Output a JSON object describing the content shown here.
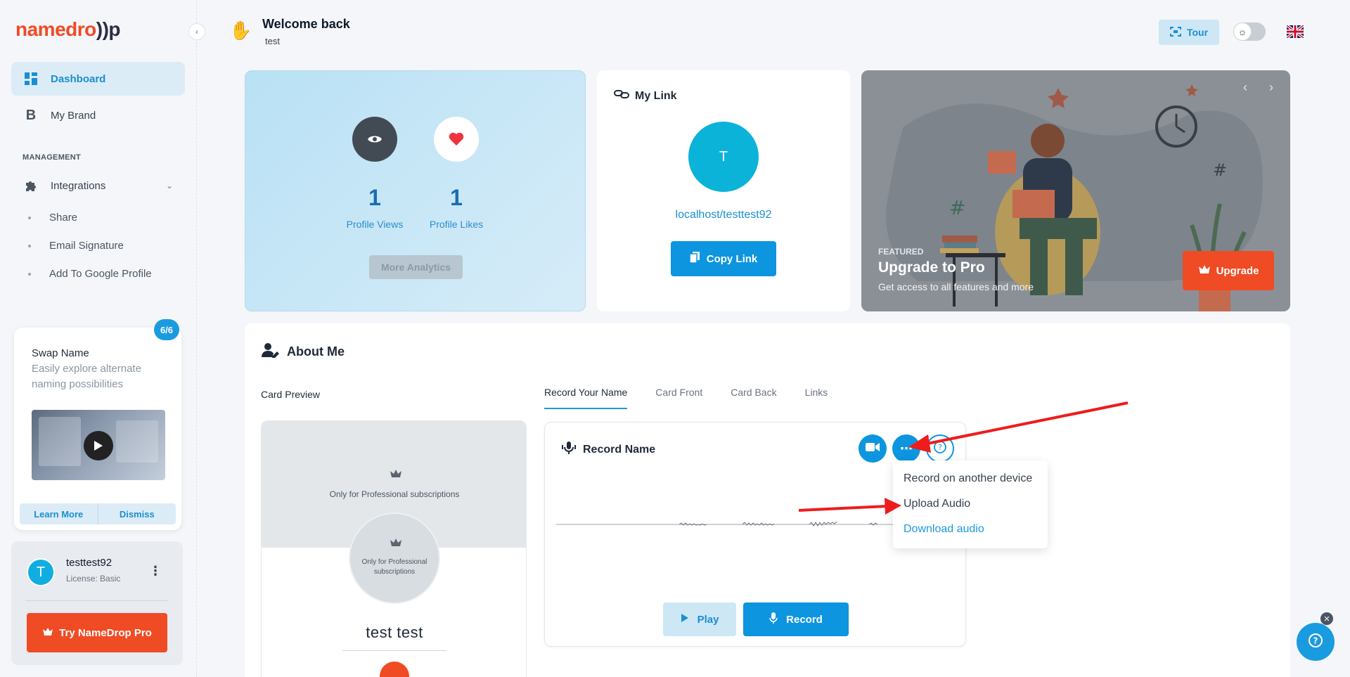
{
  "brand": {
    "logo_text": "namedro",
    "logo_suffix": "))p",
    "accent": "#ef4b24",
    "primary": "#1a9be0"
  },
  "sidebar": {
    "collapse_icon": "chevron-left-icon",
    "items": [
      {
        "label": "Dashboard",
        "icon": "dashboard-icon",
        "active": true
      },
      {
        "label": "My Brand",
        "icon": "brand-b-icon",
        "active": false
      }
    ],
    "section_label": "MANAGEMENT",
    "integrations": {
      "label": "Integrations",
      "icon": "puzzle-icon"
    },
    "sub_items": [
      "Share",
      "Email Signature",
      "Add To Google Profile"
    ],
    "swap_card": {
      "badge": "6/6",
      "title": "Swap Name",
      "description": "Easily explore alternate naming possibilities",
      "learn_more": "Learn More",
      "dismiss": "Dismiss"
    },
    "user": {
      "initial": "T",
      "name": "testtest92",
      "license": "License: Basic",
      "pro_button": "Try NameDrop Pro"
    }
  },
  "header": {
    "title": "Welcome back",
    "subtitle": "test",
    "tour_label": "Tour"
  },
  "stats": {
    "views_value": "1",
    "views_label": "Profile Views",
    "likes_value": "1",
    "likes_label": "Profile Likes",
    "more_analytics": "More Analytics"
  },
  "my_link": {
    "title": "My Link",
    "initial": "T",
    "url": "localhost/testtest92",
    "copy_label": "Copy Link"
  },
  "featured": {
    "tag": "FEATURED",
    "title": "Upgrade to Pro",
    "subtitle": "Get access to all features and more",
    "upgrade_label": "Upgrade",
    "prev": "‹",
    "next": "›"
  },
  "about": {
    "title": "About Me",
    "card_preview_label": "Card Preview",
    "preview": {
      "note_top": "Only for Professional subscriptions",
      "note_circle": "Only for Professional subscriptions",
      "name": "test test"
    },
    "tabs": [
      "Record Your Name",
      "Card Front",
      "Card Back",
      "Links"
    ],
    "active_tab": 0,
    "record": {
      "title": "Record Name",
      "play_label": "Play",
      "record_label": "Record"
    },
    "dropdown": [
      "Record on another device",
      "Upload Audio",
      "Download audio"
    ]
  }
}
